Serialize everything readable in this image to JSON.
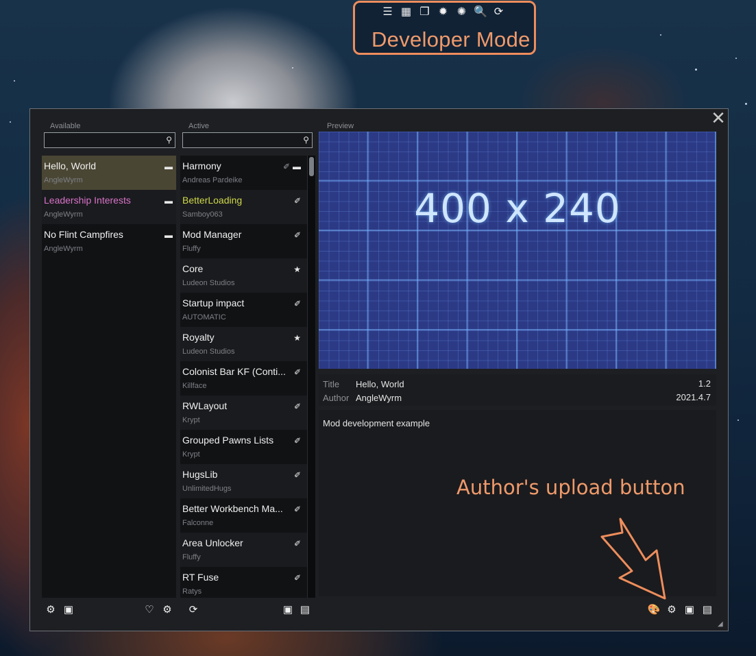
{
  "dev_toolbar": {
    "icons": [
      "log-icon",
      "table-icon",
      "windows-icon",
      "sparkle-icon",
      "sparkle-alt-icon",
      "search-icon",
      "refresh-icon"
    ],
    "glyphs": [
      "☰",
      "▦",
      "❐",
      "✹",
      "✺",
      "🔍",
      "⟳"
    ],
    "label": "Developer Mode"
  },
  "available": {
    "header": "Available",
    "search_placeholder": "",
    "items": [
      {
        "name": "Hello, World",
        "author": "AngleWyrm"
      },
      {
        "name": "Leadership Interests",
        "author": "AngleWyrm"
      },
      {
        "name": "No Flint Campfires",
        "author": "AngleWyrm"
      }
    ]
  },
  "active": {
    "header": "Active",
    "search_placeholder": "",
    "items": [
      {
        "name": "Harmony",
        "author": "Andreas Pardeike"
      },
      {
        "name": "BetterLoading",
        "author": "Samboy063"
      },
      {
        "name": "Mod Manager",
        "author": "Fluffy"
      },
      {
        "name": "Core",
        "author": "Ludeon Studios"
      },
      {
        "name": "Startup impact",
        "author": "AUTOMATIC"
      },
      {
        "name": "Royalty",
        "author": "Ludeon Studios"
      },
      {
        "name": "Colonist Bar KF (Conti...",
        "author": "Killface"
      },
      {
        "name": "RWLayout",
        "author": "Krypt"
      },
      {
        "name": "Grouped Pawns Lists",
        "author": "Krypt"
      },
      {
        "name": "HugsLib",
        "author": "UnlimitedHugs"
      },
      {
        "name": "Better Workbench Ma...",
        "author": "Falconne"
      },
      {
        "name": "Area Unlocker",
        "author": "Fluffy"
      },
      {
        "name": "RT Fuse",
        "author": "Ratys"
      }
    ]
  },
  "preview": {
    "header": "Preview",
    "image_text": "400 x 240",
    "title_key": "Title",
    "title": "Hello, World",
    "version": "1.2",
    "author_key": "Author",
    "author": "AngleWyrm",
    "date": "2021.4.7",
    "description": "Mod development example"
  },
  "annotation": "Author's upload button",
  "colors": {
    "accent": "#ee8d5c",
    "selected_row": "#4a4634",
    "pink_name": "#d873c9",
    "yellow_name": "#cfd84a"
  }
}
